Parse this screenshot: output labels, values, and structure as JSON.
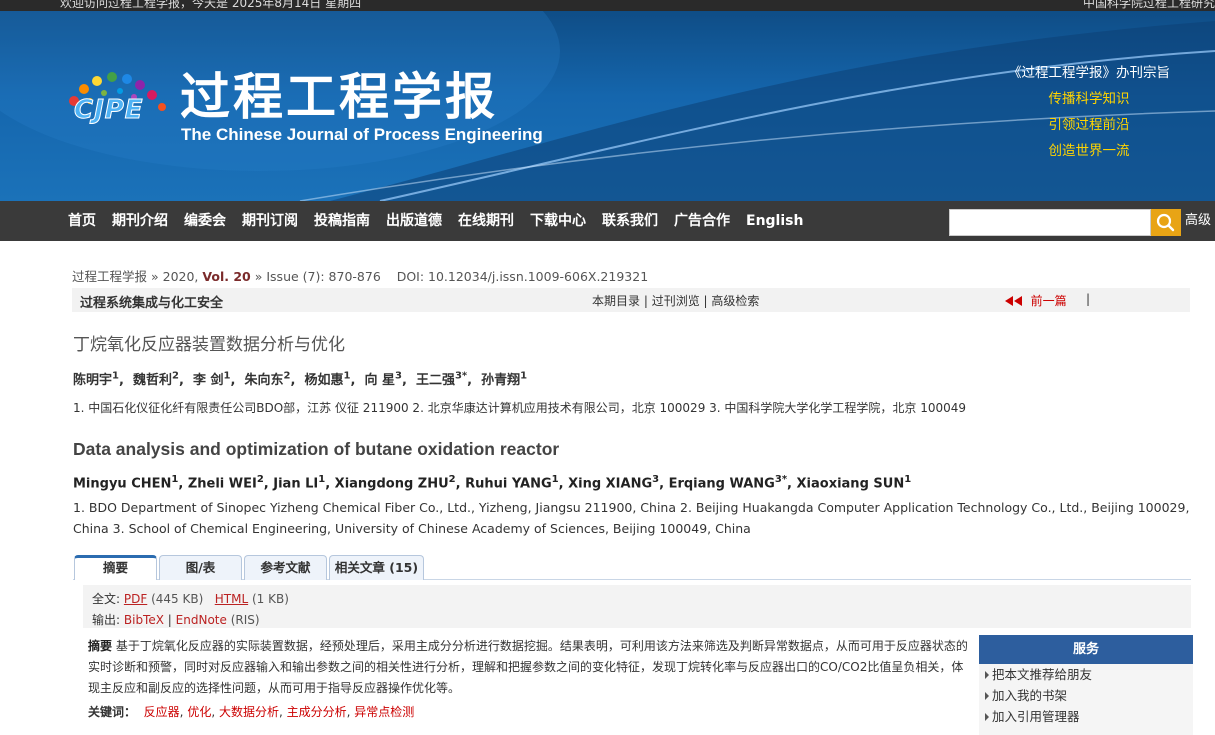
{
  "topbar": {
    "left": "欢迎访问过程工程学报，今天是 2025年8月14日 星期四",
    "right": "中国科学院过程工程研究"
  },
  "header": {
    "logo_text": "CJPE",
    "title_cn": "过程工程学报",
    "title_en": "The Chinese Journal of Process Engineering",
    "motto_head": "《过程工程学报》办刊宗旨",
    "motto_lines": [
      "传播科学知识",
      "引领过程前沿",
      "创造世界一流"
    ]
  },
  "nav": {
    "items": [
      "首页",
      "期刊介绍",
      "编委会",
      "期刊订阅",
      "投稿指南",
      "出版道德",
      "在线期刊",
      "下载中心",
      "联系我们",
      "广告合作",
      "English"
    ],
    "search_placeholder": "",
    "advanced_label": "高级"
  },
  "breadcrumb": {
    "journal": "过程工程学报",
    "year_prefix": "» 2020,",
    "vol": "Vol. 20",
    "issue": "» Issue (7): 870-876",
    "doi": "DOI: 10.12034/j.issn.1009-606X.219321"
  },
  "section_bar": {
    "section": "过程系统集成与化工安全",
    "links": [
      "本期目录",
      "过刊浏览",
      "高级检索"
    ],
    "prev": "前一篇",
    "sep": "|"
  },
  "article": {
    "title_cn": "丁烷氧化反应器装置数据分析与优化",
    "authors_cn": [
      {
        "name": "陈明宇",
        "sup": "1"
      },
      {
        "name": "魏哲利",
        "sup": "2"
      },
      {
        "name": "李 剑",
        "sup": "1"
      },
      {
        "name": "朱向东",
        "sup": "2"
      },
      {
        "name": "杨如惠",
        "sup": "1"
      },
      {
        "name": "向 星",
        "sup": "3"
      },
      {
        "name": "王二强",
        "sup": "3*"
      },
      {
        "name": "孙青翔",
        "sup": "1"
      }
    ],
    "affil_cn": "1. 中国石化仪征化纤有限责任公司BDO部，江苏 仪征 211900 2. 北京华康达计算机应用技术有限公司，北京 100029 3. 中国科学院大学化学工程学院，北京 100049",
    "title_en": "Data analysis and optimization of butane oxidation reactor",
    "authors_en": [
      {
        "name": "Mingyu CHEN",
        "sup": "1"
      },
      {
        "name": "Zheli WEI",
        "sup": "2"
      },
      {
        "name": "Jian LI",
        "sup": "1"
      },
      {
        "name": "Xiangdong ZHU",
        "sup": "2"
      },
      {
        "name": "Ruhui YANG",
        "sup": "1"
      },
      {
        "name": "Xing XIANG",
        "sup": "3"
      },
      {
        "name": "Erqiang WANG",
        "sup": "3*"
      },
      {
        "name": "Xiaoxiang SUN",
        "sup": "1"
      }
    ],
    "affil_en": "1. BDO Department of Sinopec Yizheng Chemical Fiber Co., Ltd., Yizheng, Jiangsu 211900, China 2. Beijing Huakangda Computer Application Technology Co., Ltd., Beijing 100029, China 3. School of Chemical Engineering, University of Chinese Academy of Sciences, Beijing 100049, China"
  },
  "tabs": [
    "摘要",
    "图/表",
    "参考文献",
    "相关文章 (15)"
  ],
  "downloads": {
    "fulltext_label": "全文:",
    "pdf": "PDF",
    "pdf_size": "(445 KB)",
    "html": "HTML",
    "html_size": "(1 KB)",
    "export_label": "输出:",
    "bibtex": "BibTeX",
    "pipe": "|",
    "endnote": "EndNote",
    "ris": "(RIS)"
  },
  "abstract": {
    "label": "摘要",
    "text": "基于丁烷氧化反应器的实际装置数据，经预处理后，采用主成分分析进行数据挖掘。结果表明，可利用该方法来筛选及判断异常数据点，从而可用于反应器状态的实时诊断和预警，同时对反应器输入和输出参数之间的相关性进行分析，理解和把握参数之间的变化特征，发现丁烷转化率与反应器出口的CO/CO2比值呈负相关，体现主反应和副反应的选择性问题，从而可用于指导反应器操作优化等。",
    "kw_label": "关键词：",
    "keywords": [
      "反应器",
      "优化",
      "大数据分析",
      "主成分分析",
      "异常点检测"
    ]
  },
  "services": {
    "head": "服务",
    "items": [
      "把本文推荐给朋友",
      "加入我的书架",
      "加入引用管理器"
    ]
  }
}
